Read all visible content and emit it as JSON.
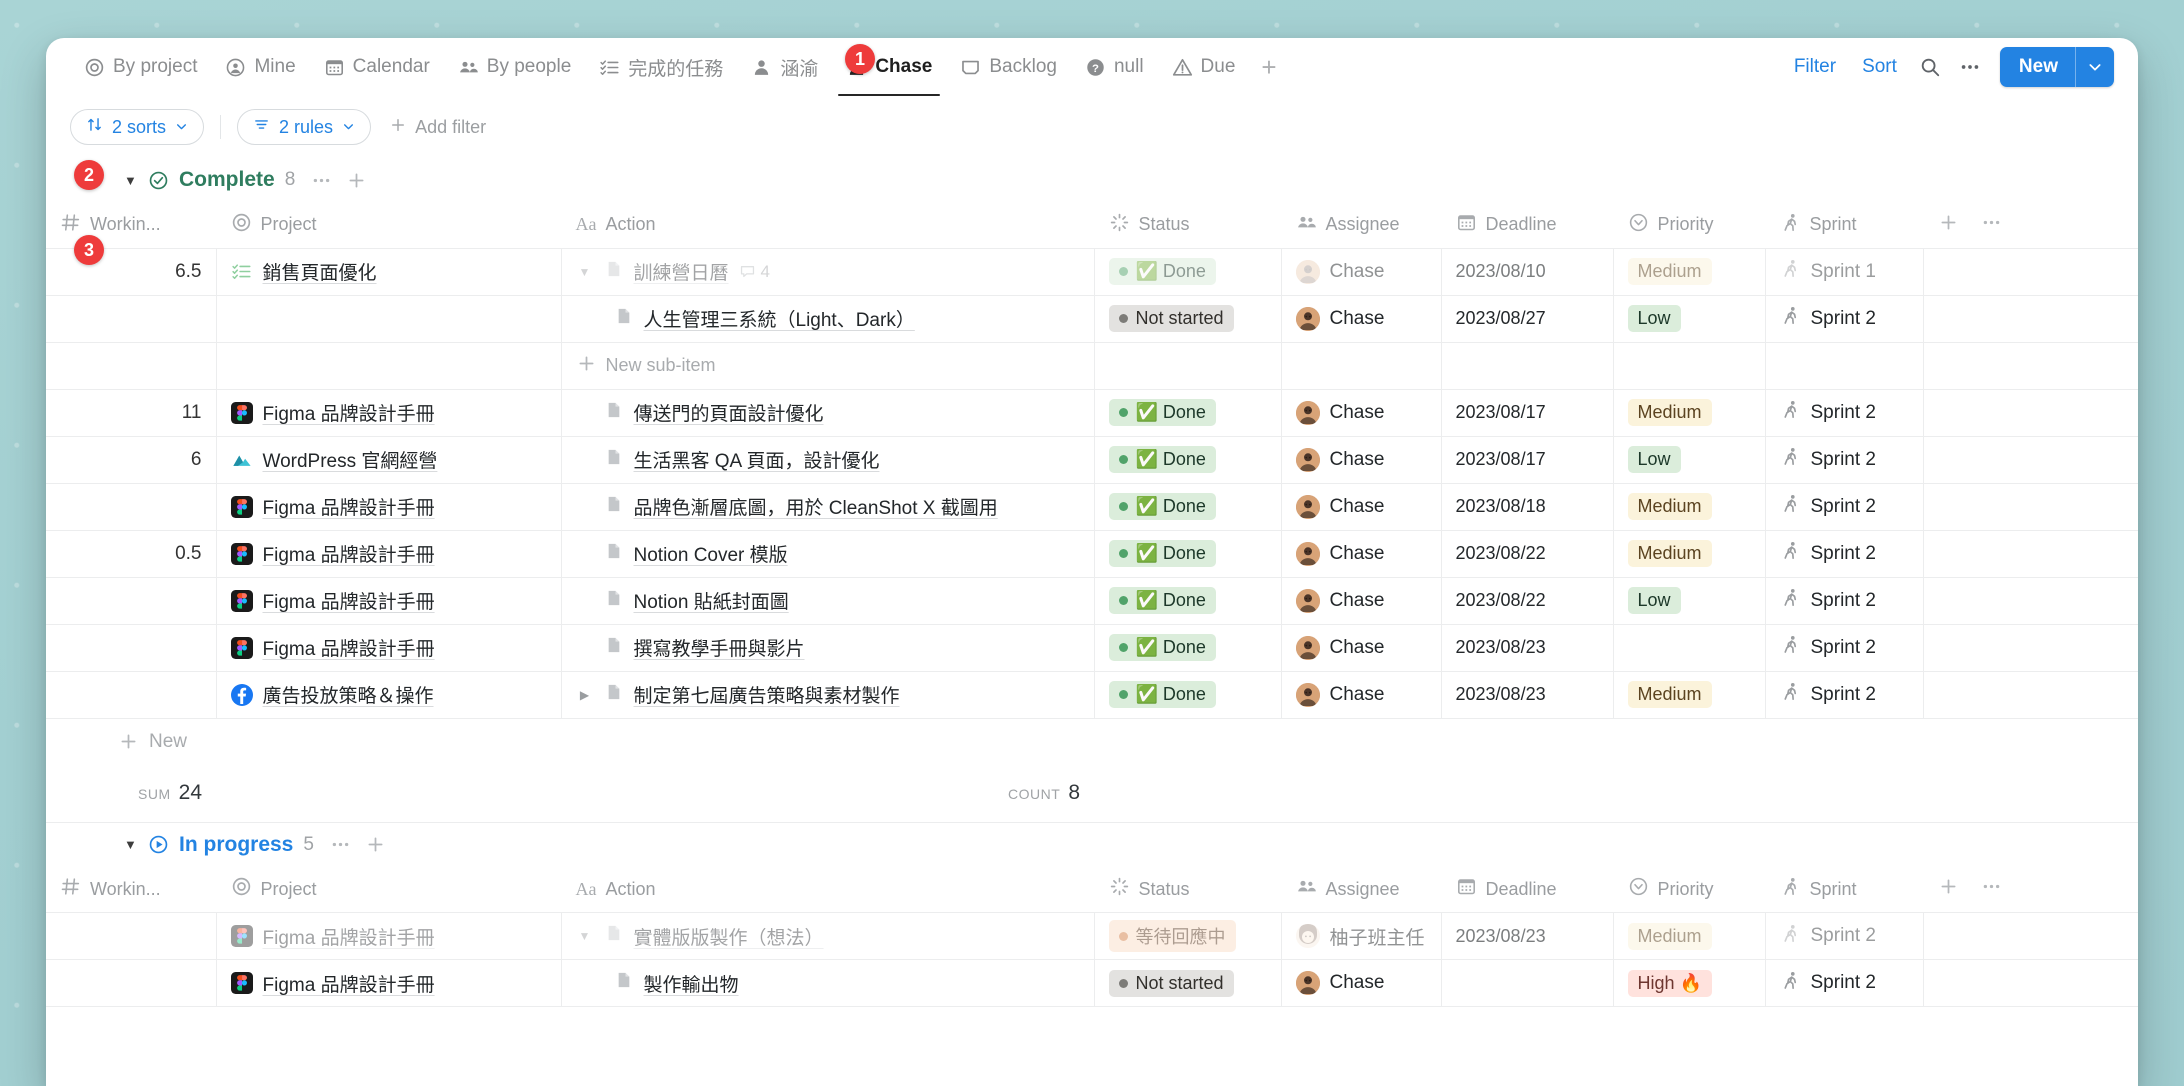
{
  "window": {
    "title": "Notion Database Table View"
  },
  "tabs": [
    {
      "label": "By project",
      "icon": "target-icon",
      "active": false
    },
    {
      "label": "Mine",
      "icon": "person-circle-icon",
      "active": false
    },
    {
      "label": "Calendar",
      "icon": "calendar-icon",
      "active": false
    },
    {
      "label": "By people",
      "icon": "people-icon",
      "active": false
    },
    {
      "label": "完成的任務",
      "icon": "checklist-icon",
      "active": false
    },
    {
      "label": "涵渝",
      "icon": "person-icon",
      "active": false,
      "badge": "1"
    },
    {
      "label": "Chase",
      "icon": "person-icon",
      "active": true
    },
    {
      "label": "Backlog",
      "icon": "inbox-icon",
      "active": false
    },
    {
      "label": "null",
      "icon": "question-circle-icon",
      "active": false
    },
    {
      "label": "Due",
      "icon": "warning-icon",
      "active": false
    }
  ],
  "tab_add_label": "+",
  "toolbar": {
    "filter_label": "Filter",
    "sort_label": "Sort",
    "search_icon": "search-icon",
    "more_icon": "ellipsis-icon",
    "new_label": "New",
    "new_chevron": "chevron-down-icon",
    "accent_color": "#2383e2"
  },
  "filterbar": {
    "sorts_label": "2 sorts",
    "rules_label": "2 rules",
    "add_filter_label": "Add filter"
  },
  "badges": [
    {
      "number": "1",
      "target": "tab-涵渝"
    },
    {
      "number": "2",
      "target": "group-complete"
    },
    {
      "number": "3",
      "target": "column-working-hours"
    }
  ],
  "columns": [
    {
      "label": "Workin...",
      "icon": "number-icon"
    },
    {
      "label": "Project",
      "icon": "target-icon"
    },
    {
      "label": "Action",
      "icon": "text-aa-icon"
    },
    {
      "label": "Status",
      "icon": "status-spinner-icon"
    },
    {
      "label": "Assignee",
      "icon": "people-icon"
    },
    {
      "label": "Deadline",
      "icon": "calendar-icon"
    },
    {
      "label": "Priority",
      "icon": "select-circle-icon"
    },
    {
      "label": "Sprint",
      "icon": "runner-icon"
    }
  ],
  "column_add_icon": "plus-icon",
  "column_more_icon": "ellipsis-icon",
  "groups": [
    {
      "name": "Complete",
      "count": "8",
      "icon": "check-circle-icon",
      "color": "#2f7d5f",
      "rows": [
        {
          "working": "6.5",
          "project": "銷售頁面優化",
          "project_icon": "checklist-icon",
          "project_icon_color": "#8fcf9f",
          "action": "訓練營日曆",
          "action_muted": true,
          "expanded": true,
          "comments": "4",
          "status": "✅ Done",
          "status_muted": true,
          "assignee": "Chase",
          "assignee_muted": true,
          "deadline": "2023/08/10",
          "priority": "Medium",
          "priority_muted": true,
          "sprint": "Sprint 1",
          "sprint_muted": true
        },
        {
          "working": "",
          "project": "",
          "action": "人生管理三系統（Light、Dark）",
          "is_subitem": true,
          "status": "Not started",
          "assignee": "Chase",
          "deadline": "2023/08/27",
          "priority": "Low",
          "sprint": "Sprint 2"
        },
        {
          "is_new_subitem": true,
          "label": "New sub-item"
        },
        {
          "working": "11",
          "project": "Figma 品牌設計手冊",
          "project_icon": "figma-icon",
          "action": "傳送門的頁面設計優化",
          "status": "✅ Done",
          "assignee": "Chase",
          "deadline": "2023/08/17",
          "priority": "Medium",
          "sprint": "Sprint 2"
        },
        {
          "working": "6",
          "project": "WordPress 官網經營",
          "project_icon": "mountain-icon",
          "action": "生活黑客 QA 頁面，設計優化",
          "status": "✅ Done",
          "assignee": "Chase",
          "deadline": "2023/08/17",
          "priority": "Low",
          "sprint": "Sprint 2"
        },
        {
          "working": "",
          "project": "Figma 品牌設計手冊",
          "project_icon": "figma-icon",
          "action": "品牌色漸層底圖，用於 CleanShot X 截圖用",
          "status": "✅ Done",
          "assignee": "Chase",
          "deadline": "2023/08/18",
          "priority": "Medium",
          "sprint": "Sprint 2"
        },
        {
          "working": "0.5",
          "project": "Figma 品牌設計手冊",
          "project_icon": "figma-icon",
          "action": "Notion Cover 模版",
          "status": "✅ Done",
          "assignee": "Chase",
          "deadline": "2023/08/22",
          "priority": "Medium",
          "sprint": "Sprint 2"
        },
        {
          "working": "",
          "project": "Figma 品牌設計手冊",
          "project_icon": "figma-icon",
          "action": "Notion 貼紙封面圖",
          "status": "✅ Done",
          "assignee": "Chase",
          "deadline": "2023/08/22",
          "priority": "Low",
          "sprint": "Sprint 2"
        },
        {
          "working": "",
          "project": "Figma 品牌設計手冊",
          "project_icon": "figma-icon",
          "action": "撰寫教學手冊與影片",
          "status": "✅ Done",
          "assignee": "Chase",
          "deadline": "2023/08/23",
          "priority": "",
          "sprint": "Sprint 2"
        },
        {
          "working": "",
          "project": "廣告投放策略＆操作",
          "project_icon": "facebook-icon",
          "action": "制定第七屆廣告策略與素材製作",
          "collapsed": true,
          "status": "✅ Done",
          "assignee": "Chase",
          "deadline": "2023/08/23",
          "priority": "Medium",
          "sprint": "Sprint 2"
        }
      ],
      "new_row_label": "New",
      "summary": {
        "sum_label": "SUM",
        "sum_value": "24",
        "count_label": "COUNT",
        "count_value": "8"
      }
    },
    {
      "name": "In progress",
      "count": "5",
      "icon": "play-circle-icon",
      "color": "#2383e2",
      "rows": [
        {
          "working": "",
          "project": "Figma 品牌設計手冊",
          "project_icon": "figma-icon",
          "project_muted": true,
          "action": "實體版版製作（想法）",
          "action_muted": true,
          "expanded": true,
          "status": "等待回應中",
          "status_muted": true,
          "assignee": "柚子班主任",
          "assignee_muted": true,
          "deadline": "2023/08/23",
          "priority": "Medium",
          "priority_muted": true,
          "sprint": "Sprint 2",
          "sprint_muted": true
        },
        {
          "working": "",
          "project": "Figma 品牌設計手冊",
          "project_icon": "figma-icon",
          "action": "製作輸出物",
          "is_subitem": true,
          "status": "Not started",
          "assignee": "Chase",
          "deadline": "",
          "priority": "High 🔥",
          "sprint": "Sprint 2"
        }
      ]
    }
  ],
  "colors": {
    "done_bg": "#dbeddb",
    "done_text": "#1c3829",
    "notstarted_bg": "#e3e2e0",
    "notstarted_text": "#32302c",
    "waiting_bg": "#fadec9",
    "waiting_text": "#5c3b23",
    "medium_bg": "#fbf3db",
    "medium_text": "#5b4320",
    "low_bg": "#dbeddb",
    "low_text": "#1c3829",
    "high_bg": "#ffe2dd",
    "high_text": "#6e3630",
    "badge_red": "#ee3b3b"
  }
}
